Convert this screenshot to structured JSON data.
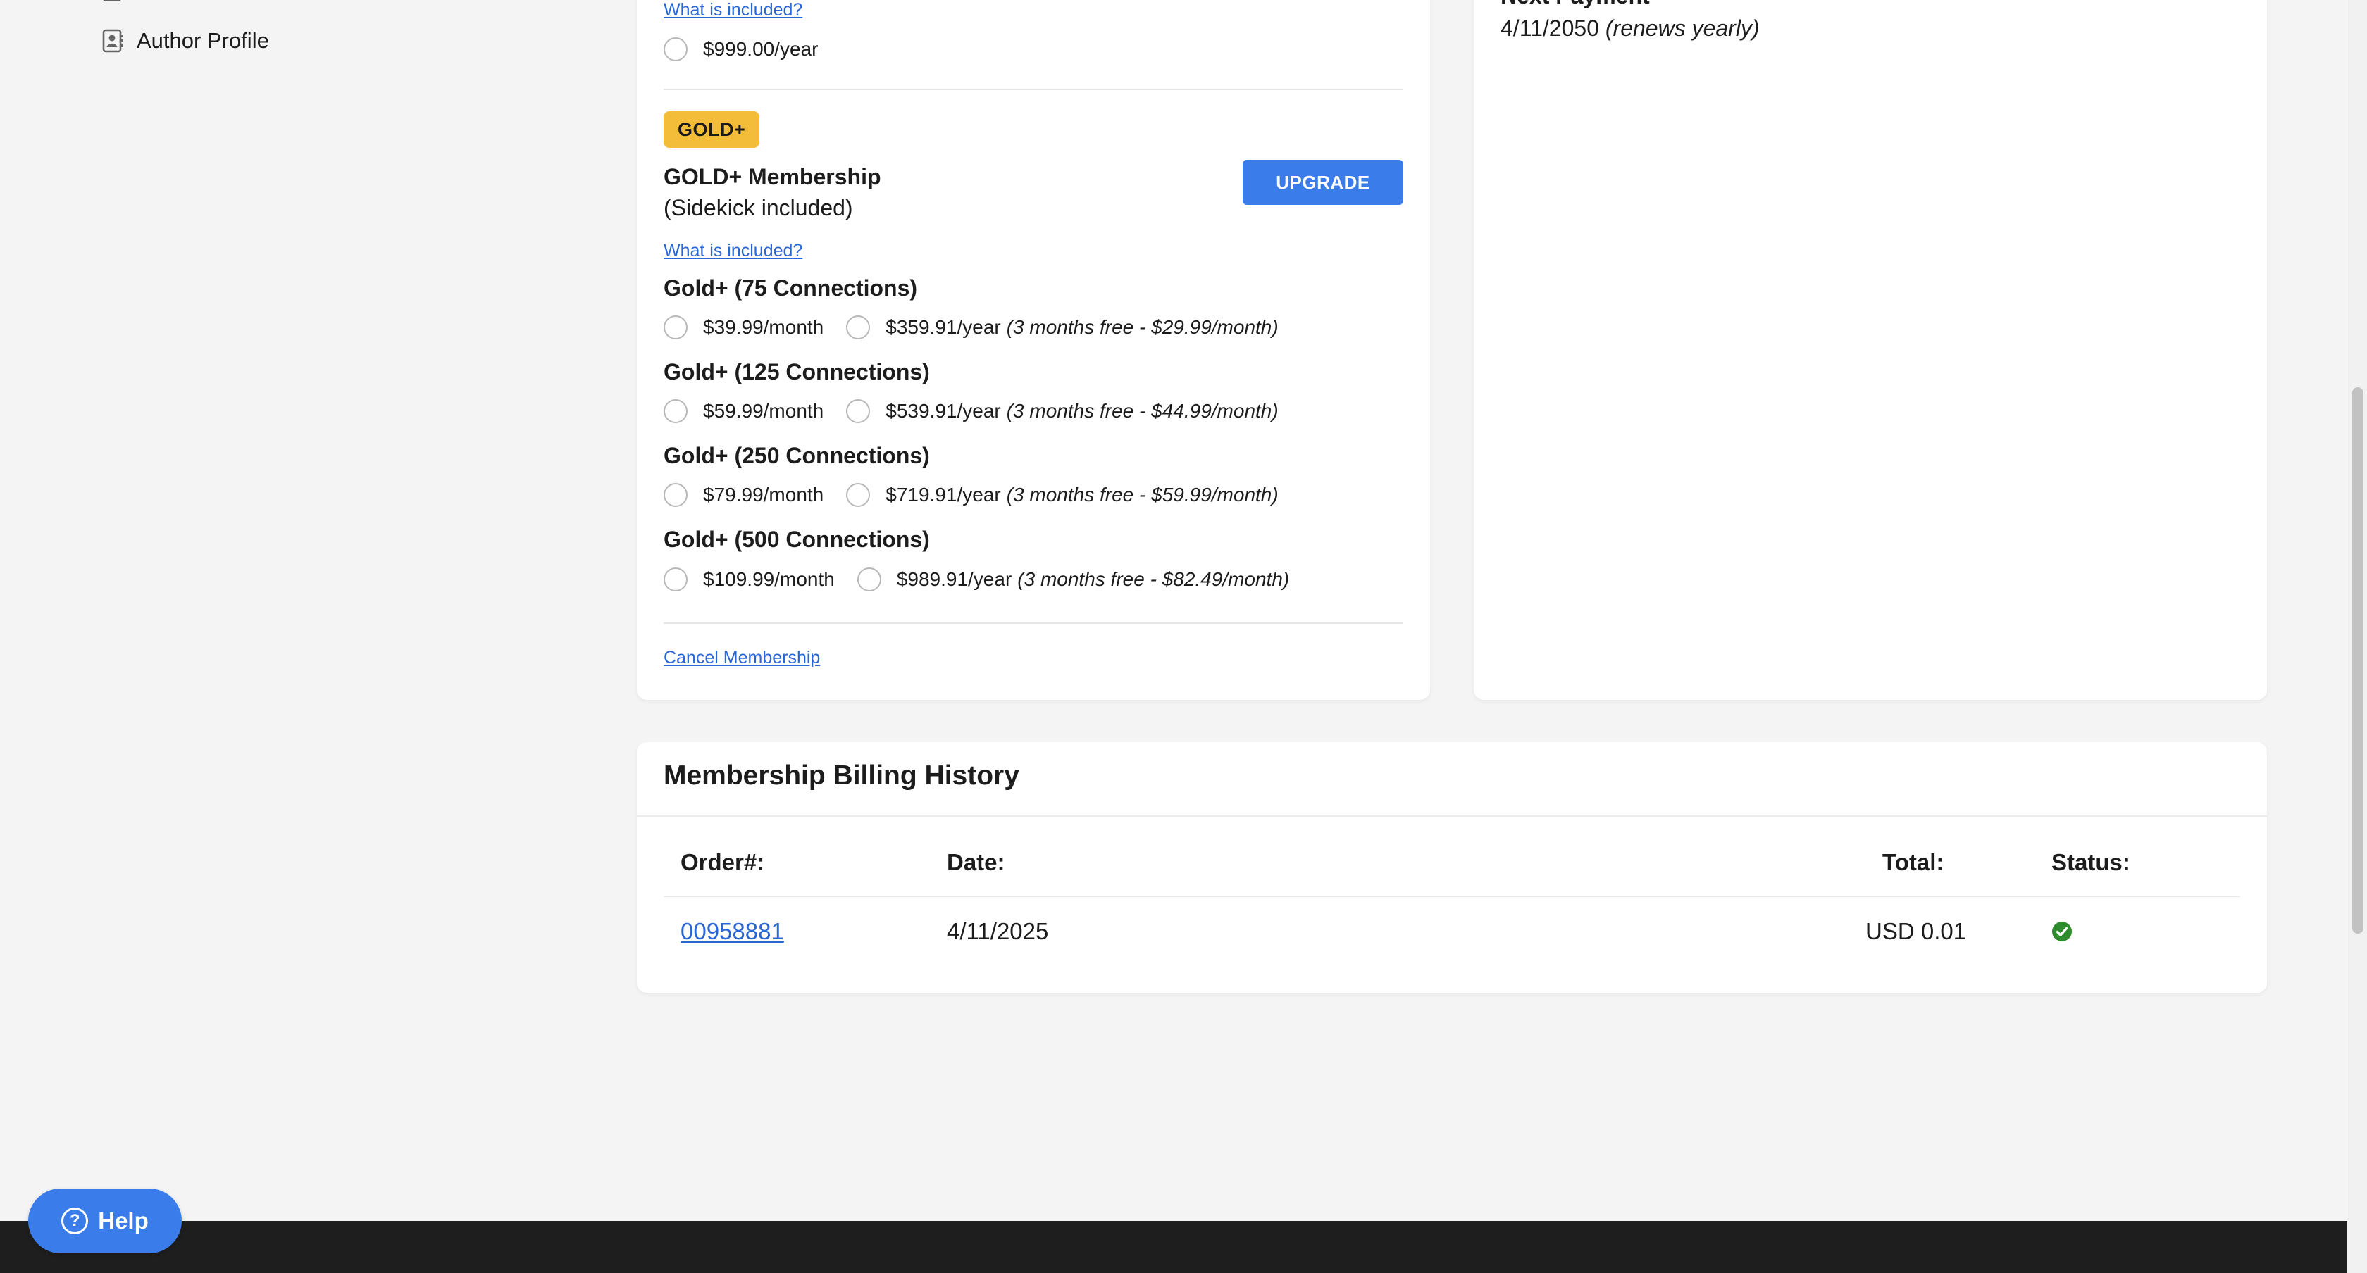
{
  "sidebar": {
    "author_profile_label": "Author Profile"
  },
  "current_plan": {
    "what_included_link": "What is included?",
    "option_price": "$999.00/year"
  },
  "gold_plus": {
    "badge": "GOLD+",
    "title": "GOLD+ Membership",
    "subtitle": "(Sidekick included)",
    "upgrade_label": "UPGRADE",
    "what_included_link": "What is included?",
    "tiers": [
      {
        "heading": "Gold+ (75 Connections)",
        "monthly": "$39.99/month",
        "yearly": "$359.91/year",
        "yearly_note": "(3 months free - $29.99/month)"
      },
      {
        "heading": "Gold+ (125 Connections)",
        "monthly": "$59.99/month",
        "yearly": "$539.91/year",
        "yearly_note": "(3 months free - $44.99/month)"
      },
      {
        "heading": "Gold+ (250 Connections)",
        "monthly": "$79.99/month",
        "yearly": "$719.91/year",
        "yearly_note": "(3 months free - $59.99/month)"
      },
      {
        "heading": "Gold+ (500 Connections)",
        "monthly": "$109.99/month",
        "yearly": "$989.91/year",
        "yearly_note": "(3 months free - $82.49/month)"
      }
    ],
    "cancel_link": "Cancel Membership"
  },
  "next_payment": {
    "label": "Next Payment",
    "date": "4/11/2050",
    "note": "(renews yearly)"
  },
  "billing_history": {
    "title": "Membership Billing History",
    "columns": {
      "order": "Order#:",
      "date": "Date:",
      "total": "Total:",
      "status": "Status:"
    },
    "rows": [
      {
        "order": "00958881",
        "date": "4/11/2025",
        "total": "USD 0.01",
        "status_icon": "check-circle-icon",
        "status_color": "#2e8b2e"
      }
    ]
  },
  "help": {
    "label": "Help"
  },
  "colors": {
    "accent": "#3a7dea",
    "gold_badge": "#f3bd3a",
    "link": "#2a66d4",
    "footer": "#1e1e1e"
  }
}
